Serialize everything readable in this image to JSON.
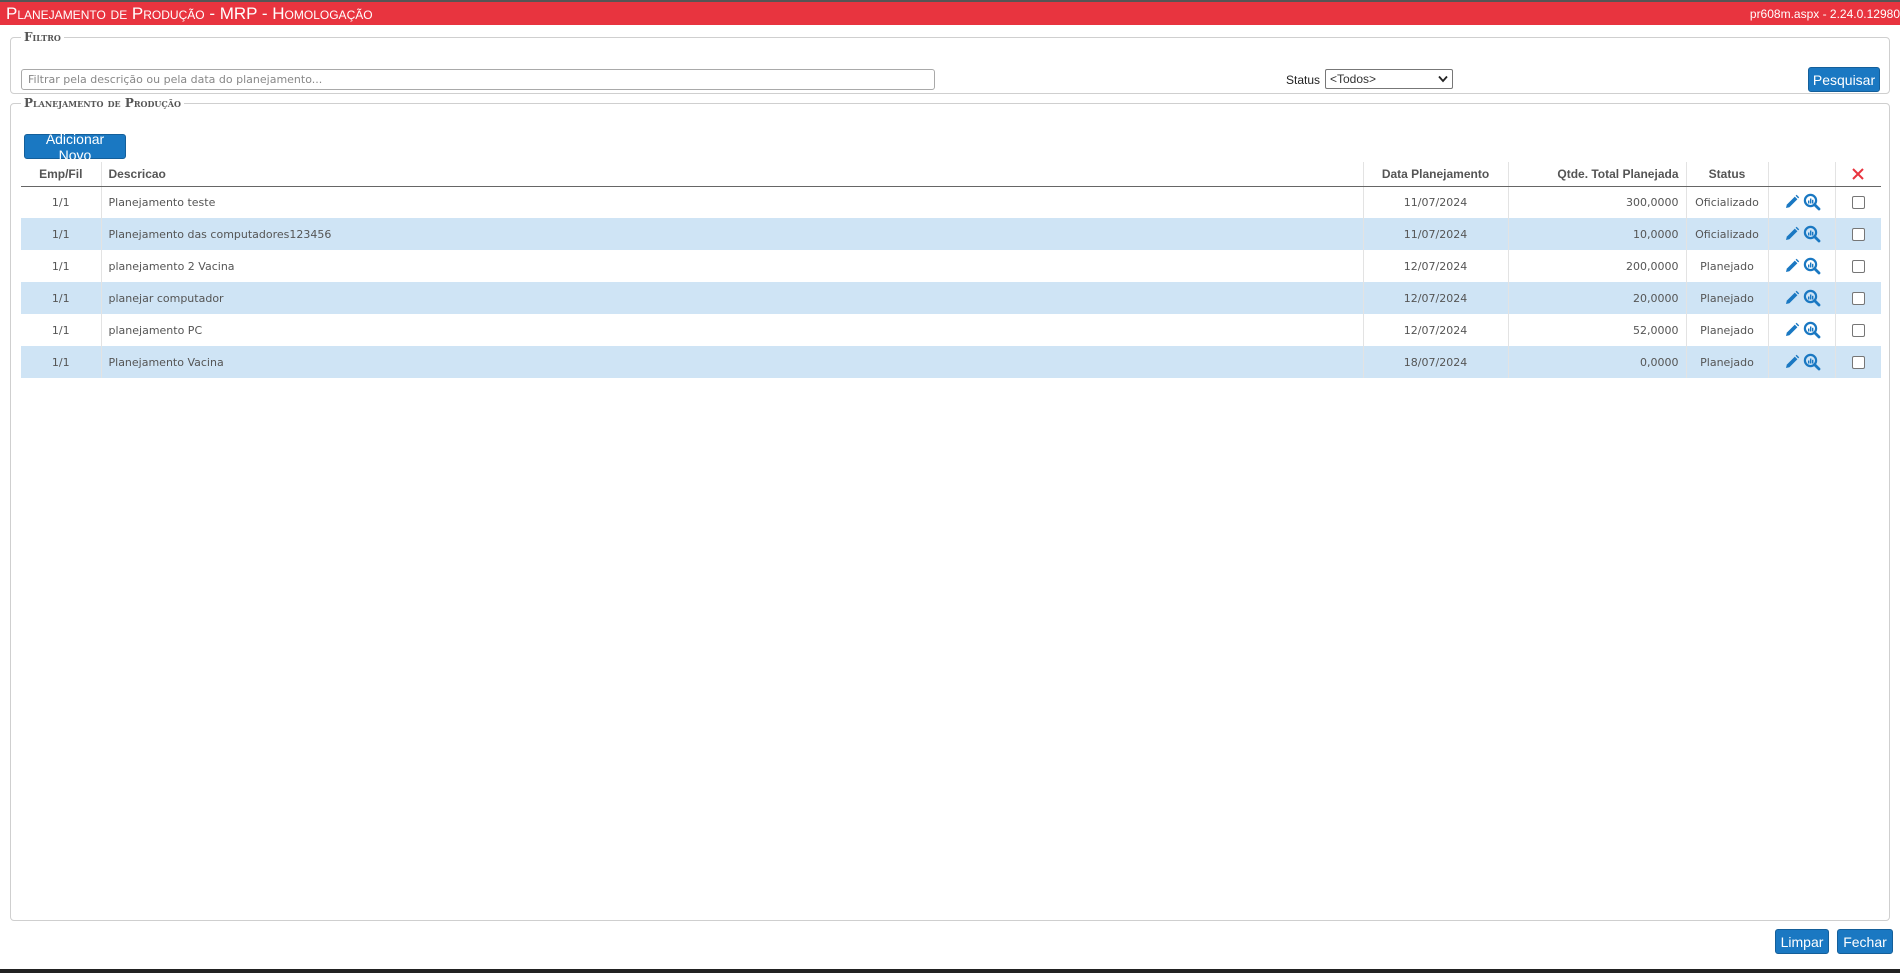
{
  "header": {
    "title": "Planejamento de Produção - MRP  - Homologação",
    "version": "pr608m.aspx - 2.24.0.12980"
  },
  "filter": {
    "legend": "Filtro",
    "placeholder": "Filtrar pela descrição ou pela data do planejamento...",
    "status_label": "Status",
    "status_selected": "<Todos>",
    "search_label": "Pesquisar"
  },
  "plan": {
    "legend": "Planejamento de Produção",
    "add_label": "Adicionar Novo",
    "columns": [
      "Emp/Fil",
      "Descricao",
      "Data Planejamento",
      "Qtde. Total Planejada",
      "Status"
    ],
    "rows": [
      {
        "emp": "1/1",
        "desc": "Planejamento teste",
        "data": "11/07/2024",
        "qtde": "300,0000",
        "status": "Oficializado"
      },
      {
        "emp": "1/1",
        "desc": "Planejamento das computadores123456",
        "data": "11/07/2024",
        "qtde": "10,0000",
        "status": "Oficializado"
      },
      {
        "emp": "1/1",
        "desc": "planejamento 2 Vacina",
        "data": "12/07/2024",
        "qtde": "200,0000",
        "status": "Planejado"
      },
      {
        "emp": "1/1",
        "desc": "planejar computador",
        "data": "12/07/2024",
        "qtde": "20,0000",
        "status": "Planejado"
      },
      {
        "emp": "1/1",
        "desc": "planejamento PC",
        "data": "12/07/2024",
        "qtde": "52,0000",
        "status": "Planejado"
      },
      {
        "emp": "1/1",
        "desc": "Planejamento Vacina",
        "data": "18/07/2024",
        "qtde": "0,0000",
        "status": "Planejado"
      }
    ]
  },
  "footer": {
    "clear_label": "Limpar",
    "close_label": "Fechar"
  },
  "colors": {
    "titlebar": "#e8343f",
    "button": "#1a78c2",
    "row_alt": "#cfe4f5",
    "delete_icon": "#e8343f"
  },
  "icons": {
    "edit": "pencil-icon",
    "view": "magnifier-chart-icon",
    "delete_all": "close-x-icon"
  }
}
